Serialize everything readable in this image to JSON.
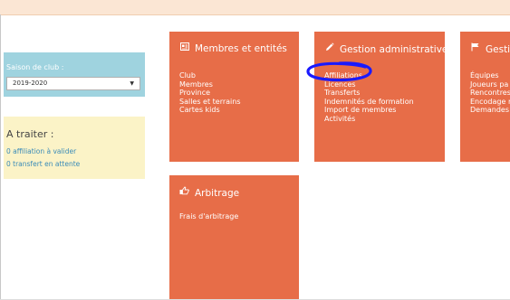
{
  "season": {
    "label": "Saison de club :",
    "selected": "2019-2020"
  },
  "todo": {
    "title": "A traiter :",
    "items": [
      "0 affiliation à valider",
      "0 transfert en attente"
    ]
  },
  "tiles": [
    {
      "title": "Membres et entités",
      "icon": "id-card-icon",
      "items": [
        "Club",
        "Membres",
        "Province",
        "Salles et terrains",
        "Cartes kids"
      ]
    },
    {
      "title": "Gestion administrative",
      "icon": "pencil-icon",
      "items": [
        "Affiliations",
        "Licences",
        "Transferts",
        "Indemnités de formation",
        "Import de membres",
        "Activités"
      ]
    },
    {
      "title": "Gestio",
      "icon": "flag-icon",
      "items": [
        "Équipes",
        "Joueurs pa",
        "Rencontres",
        "Encodage r",
        "Demandes"
      ]
    },
    {
      "title": "Arbitrage",
      "icon": "hand-pointer-icon",
      "items": [
        "Frais d'arbitrage"
      ]
    }
  ],
  "annotation": {
    "color": "#1a1aff"
  }
}
